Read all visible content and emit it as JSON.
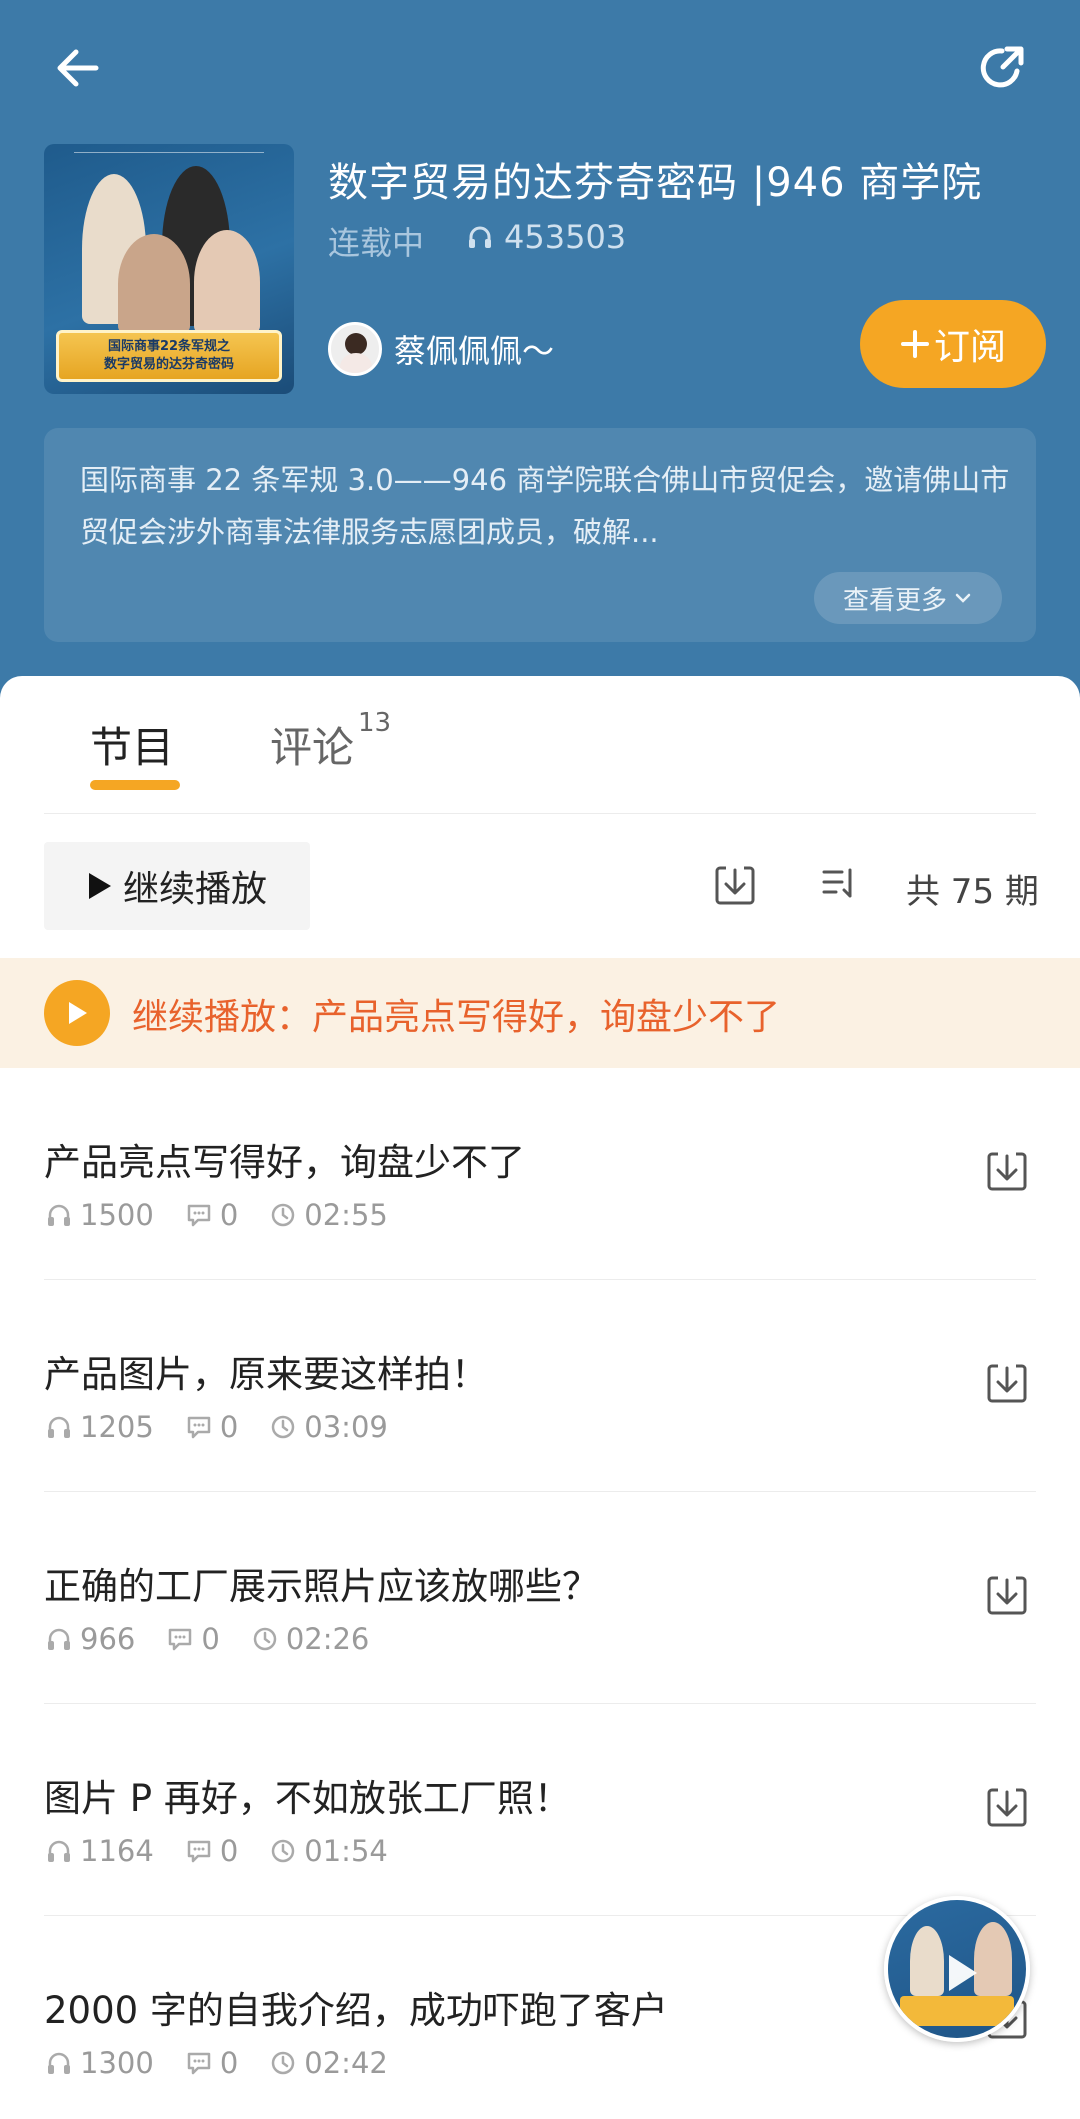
{
  "header": {
    "title": "数字贸易的达芬奇密码 |946 商学院",
    "status": "连载中",
    "play_count": "453503",
    "author": "蔡佩佩佩～",
    "subscribe_label": "订阅",
    "description": "国际商事 22 条军规 3.0——946 商学院联合佛山市贸促会，邀请佛山市贸促会涉外商事法律服务志愿团成员，破解...",
    "more_label": "查看更多",
    "cover": {
      "banner_line1": "国际商事22条军规之",
      "banner_line2": "数字贸易的达芬奇密码"
    }
  },
  "tabs": {
    "programs": "节目",
    "comments": "评论",
    "comments_count": "13"
  },
  "toolbar": {
    "continue_label": "继续播放",
    "total": "共 75 期"
  },
  "resume": {
    "text": "继续播放：产品亮点写得好，询盘少不了"
  },
  "episodes": [
    {
      "title": "产品亮点写得好，询盘少不了",
      "plays": "1500",
      "comments": "0",
      "duration": "02:55"
    },
    {
      "title": "产品图片，原来要这样拍！",
      "plays": "1205",
      "comments": "0",
      "duration": "03:09"
    },
    {
      "title": "正确的工厂展示照片应该放哪些？",
      "plays": "966",
      "comments": "0",
      "duration": "02:26"
    },
    {
      "title": "图片 P 再好，不如放张工厂照！",
      "plays": "1164",
      "comments": "0",
      "duration": "01:54"
    },
    {
      "title": "2000 字的自我介绍，成功吓跑了客户",
      "plays": "1300",
      "comments": "0",
      "duration": "02:42"
    }
  ],
  "icons": {
    "back": "arrow-left-icon",
    "share": "share-icon",
    "headphones": "headphones-icon",
    "comment": "comment-icon",
    "clock": "clock-icon",
    "download": "download-icon",
    "sort": "sort-icon",
    "play": "play-icon"
  },
  "colors": {
    "header_bg": "#3d7aa8",
    "accent": "#f5a623",
    "resume_text": "#e8622c",
    "resume_bg": "#fbf1e3"
  }
}
